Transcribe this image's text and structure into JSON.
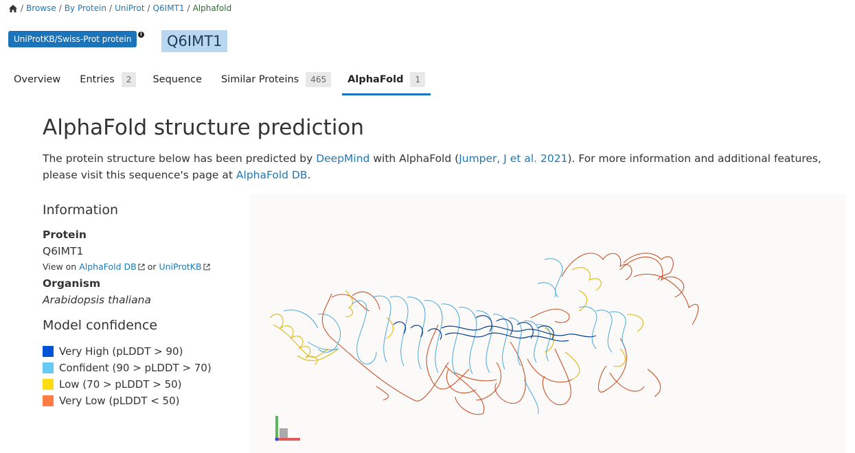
{
  "breadcrumb": {
    "items": [
      "Browse",
      "By Protein",
      "UniProt",
      "Q6IMT1"
    ],
    "current": "Alphafold",
    "separator": "/"
  },
  "header": {
    "badge": "UniProtKB/Swiss-Prot protein",
    "accession": "Q6IMT1"
  },
  "tabs": [
    {
      "label": "Overview",
      "count": null
    },
    {
      "label": "Entries",
      "count": "2"
    },
    {
      "label": "Sequence",
      "count": null
    },
    {
      "label": "Similar Proteins",
      "count": "465"
    },
    {
      "label": "AlphaFold",
      "count": "1"
    }
  ],
  "main": {
    "title": "AlphaFold structure prediction",
    "intro": {
      "t1": "The protein structure below has been predicted by ",
      "link1": "DeepMind",
      "t2": " with AlphaFold (",
      "link2": "Jumper, J et al. 2021",
      "t3": "). For more information and additional features, please visit this sequence's page at ",
      "link3": "AlphaFold DB",
      "t4": "."
    }
  },
  "info": {
    "heading": "Information",
    "protein_label": "Protein",
    "protein_value": "Q6IMT1",
    "view_on": "View on",
    "link_alphafold": "AlphaFold DB",
    "or": "or",
    "link_uniprot": "UniProtKB",
    "organism_label": "Organism",
    "organism_value": "Arabidopsis thaliana"
  },
  "confidence": {
    "heading": "Model confidence",
    "items": [
      {
        "label": "Very High (pLDDT > 90)",
        "color": "#0053d6"
      },
      {
        "label": "Confident (90 > pLDDT > 70)",
        "color": "#65cbf3"
      },
      {
        "label": "Low (70 > pLDDT > 50)",
        "color": "#ffdb13"
      },
      {
        "label": "Very Low (pLDDT < 50)",
        "color": "#ff7d45"
      }
    ]
  },
  "colors": {
    "primary": "#1b74b9",
    "accession_bg": "#b9d7ee",
    "link": "#1f77b4"
  }
}
